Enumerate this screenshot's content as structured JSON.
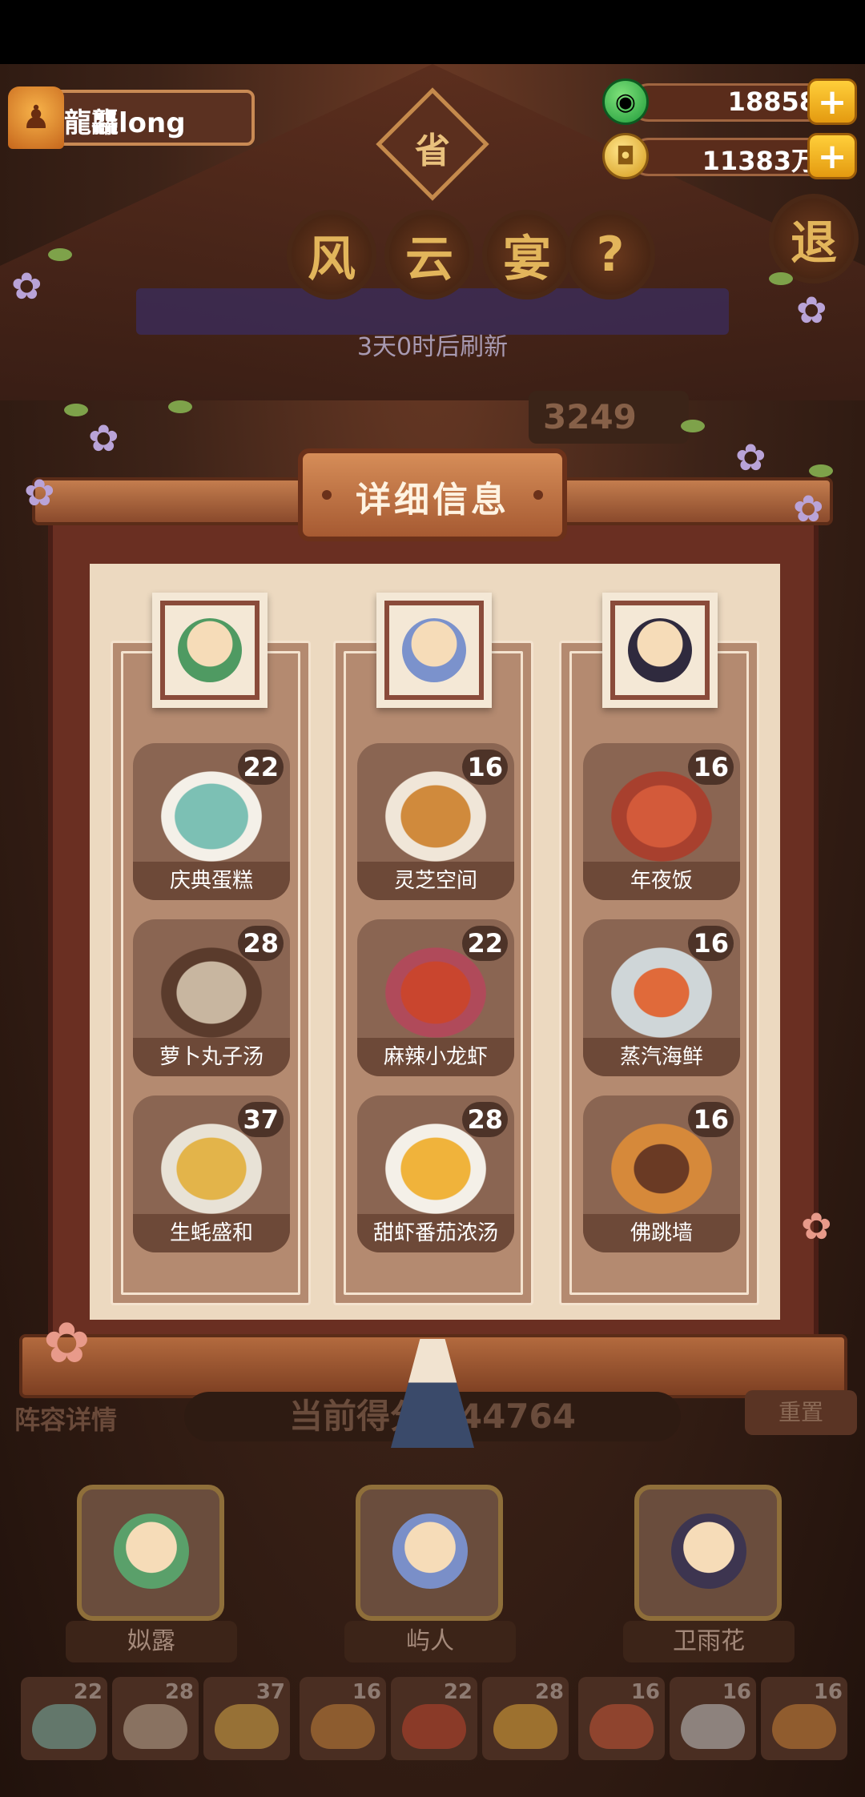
{
  "player": {
    "name": "龍龘long"
  },
  "currency": [
    {
      "icon": "jade-icon",
      "value": "18858",
      "plus": "+"
    },
    {
      "icon": "coin-icon",
      "value": "11383万",
      "plus": "+"
    }
  ],
  "event": {
    "province_badge": "省",
    "title_chars": [
      "风",
      "云",
      "宴"
    ],
    "help": "?",
    "exit": "退",
    "refresh_text": "3天0时后刷新",
    "score_behind": "3249"
  },
  "modal": {
    "title": "详细信息",
    "columns": [
      {
        "chef_icon": "chef-portrait-green",
        "dishes": [
          {
            "name": "庆典蛋糕",
            "count": "22",
            "color": "#7cc0b4"
          },
          {
            "name": "萝卜丸子汤",
            "count": "28",
            "color": "#c8b6a0"
          },
          {
            "name": "生蚝盛和",
            "count": "37",
            "color": "#e3b44a"
          }
        ]
      },
      {
        "chef_icon": "chef-portrait-blue",
        "dishes": [
          {
            "name": "灵芝空间",
            "count": "16",
            "color": "#d08a3c"
          },
          {
            "name": "麻辣小龙虾",
            "count": "22",
            "color": "#c9452e"
          },
          {
            "name": "甜虾番茄浓汤",
            "count": "28",
            "color": "#f0b33b"
          }
        ]
      },
      {
        "chef_icon": "chef-portrait-dark",
        "dishes": [
          {
            "name": "年夜饭",
            "count": "16",
            "color": "#d35a3a"
          },
          {
            "name": "蒸汽海鲜",
            "count": "16",
            "color": "#cfd6d8"
          },
          {
            "name": "佛跳墙",
            "count": "16",
            "color": "#d6893a"
          }
        ]
      }
    ]
  },
  "lineup": {
    "label": "阵容详情",
    "current_score": "当前得分 544764",
    "reset": "重置"
  },
  "chefs": [
    {
      "name": "姒露",
      "color": "#5aa06a"
    },
    {
      "name": "屿人",
      "color": "#7a8fc8"
    },
    {
      "name": "卫雨花",
      "color": "#3d3550"
    }
  ],
  "slots": [
    {
      "count": "22",
      "color": "#7cc0b4"
    },
    {
      "count": "28",
      "color": "#c8b6a0"
    },
    {
      "count": "37",
      "color": "#e3b44a"
    },
    {
      "count": "16",
      "color": "#d08a3c"
    },
    {
      "count": "22",
      "color": "#c9452e"
    },
    {
      "count": "28",
      "color": "#f0b33b"
    },
    {
      "count": "16",
      "color": "#d35a3a"
    },
    {
      "count": "16",
      "color": "#cfd6d8"
    },
    {
      "count": "16",
      "color": "#d6893a"
    }
  ],
  "colors": {
    "frame": "#6a2f22",
    "parchment": "#ecd9c0",
    "accent_gold": "#e2b55b"
  }
}
